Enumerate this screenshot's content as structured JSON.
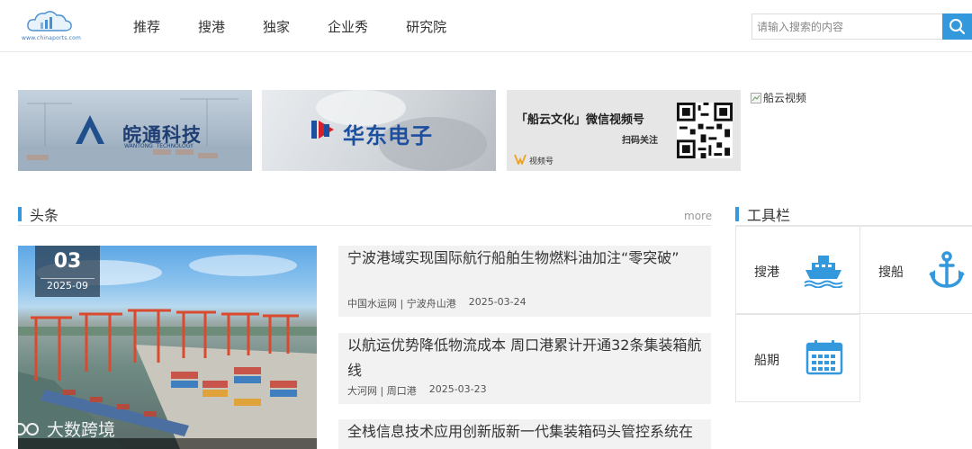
{
  "header": {
    "logo_url_text": "www.chinaports.com",
    "nav": [
      "推荐",
      "搜港",
      "独家",
      "企业秀",
      "研究院"
    ],
    "search_placeholder": "请输入搜索的内容"
  },
  "banners": {
    "b1_brand": "皖通科技",
    "b1_sub": "WANTONG  TECHNOLOGY",
    "b2_brand": "华东电子",
    "b3_title": "「船云文化」微信视频号",
    "b3_sub": "扫码关注",
    "b3_tag": "视频号",
    "b4_alt": "船云视频"
  },
  "headline": {
    "section_title": "头条",
    "more_label": "more",
    "feature_day": "03",
    "feature_ym": "2025-09"
  },
  "news": [
    {
      "title": "宁波港域实现国际航行船舶生物燃料油加注“零突破”",
      "source": "中国水运网 | 宁波舟山港",
      "date": "2025-03-24"
    },
    {
      "title": "以航运优势降低物流成本 周口港累计开通32条集装箱航线",
      "source": "大河网 | 周口港",
      "date": "2025-03-23"
    },
    {
      "title": "全栈信息技术应用创新版新一代集装箱码头管控系统在",
      "source": "",
      "date": ""
    }
  ],
  "tools": {
    "section_title": "工具栏",
    "items": [
      {
        "label": "搜港",
        "icon": "ship-icon"
      },
      {
        "label": "搜船",
        "icon": "anchor-icon"
      },
      {
        "label": "船期",
        "icon": "calendar-icon"
      }
    ]
  },
  "watermark": {
    "text": "大数跨境"
  },
  "colors": {
    "accent": "#3398dc"
  }
}
